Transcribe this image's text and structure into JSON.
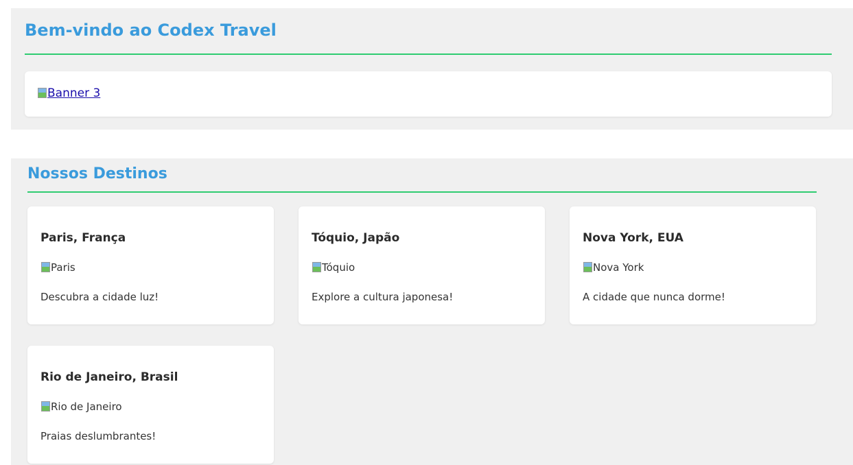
{
  "header": {
    "title": "Bem-vindo ao Codex Travel",
    "banner_alt": "Banner 3"
  },
  "colors": {
    "heading": "#3a9bdc",
    "rule": "#2ecc71",
    "section_bg": "#f0f0f0",
    "card_bg": "#ffffff",
    "link": "#1a0dab"
  },
  "destinations": {
    "title": "Nossos Destinos",
    "cards": [
      {
        "title": "Paris, França",
        "image_alt": "Paris",
        "description": "Descubra a cidade luz!"
      },
      {
        "title": "Tóquio, Japão",
        "image_alt": "Tóquio",
        "description": "Explore a cultura japonesa!"
      },
      {
        "title": "Nova York, EUA",
        "image_alt": "Nova York",
        "description": "A cidade que nunca dorme!"
      },
      {
        "title": "Rio de Janeiro, Brasil",
        "image_alt": "Rio de Janeiro",
        "description": "Praias deslumbrantes!"
      }
    ]
  },
  "icons": {
    "broken_image": "broken-image-icon"
  }
}
